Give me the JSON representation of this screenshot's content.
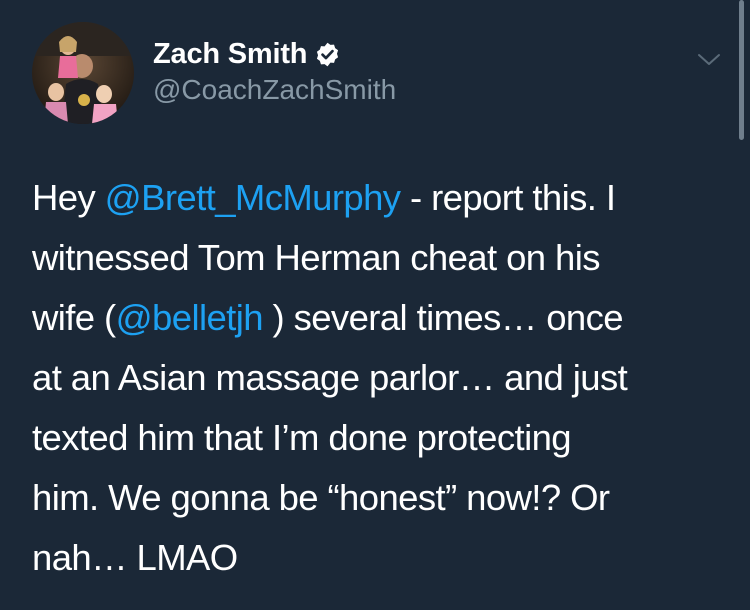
{
  "tweet": {
    "display_name": "Zach Smith",
    "handle": "@CoachZachSmith",
    "verified": true,
    "accent_color": "#1da1f2",
    "background_color": "#1b2837",
    "icons": {
      "verified": "verified-badge-icon",
      "menu": "chevron-down-icon"
    },
    "body": {
      "line1_a": "Hey ",
      "line1_mention": "@Brett_McMurphy",
      "line1_b": " - report this.  I",
      "line2": "witnessed Tom Herman cheat on his",
      "line3_a": "wife (",
      "line3_mention": "@belletjh",
      "line3_b": " ) several times… once",
      "line4": "at an Asian massage parlor… and just",
      "line5": "texted him that I’m done protecting",
      "line6": "him.  We gonna be “honest” now!?  Or",
      "line7": "nah… LMAO"
    }
  }
}
